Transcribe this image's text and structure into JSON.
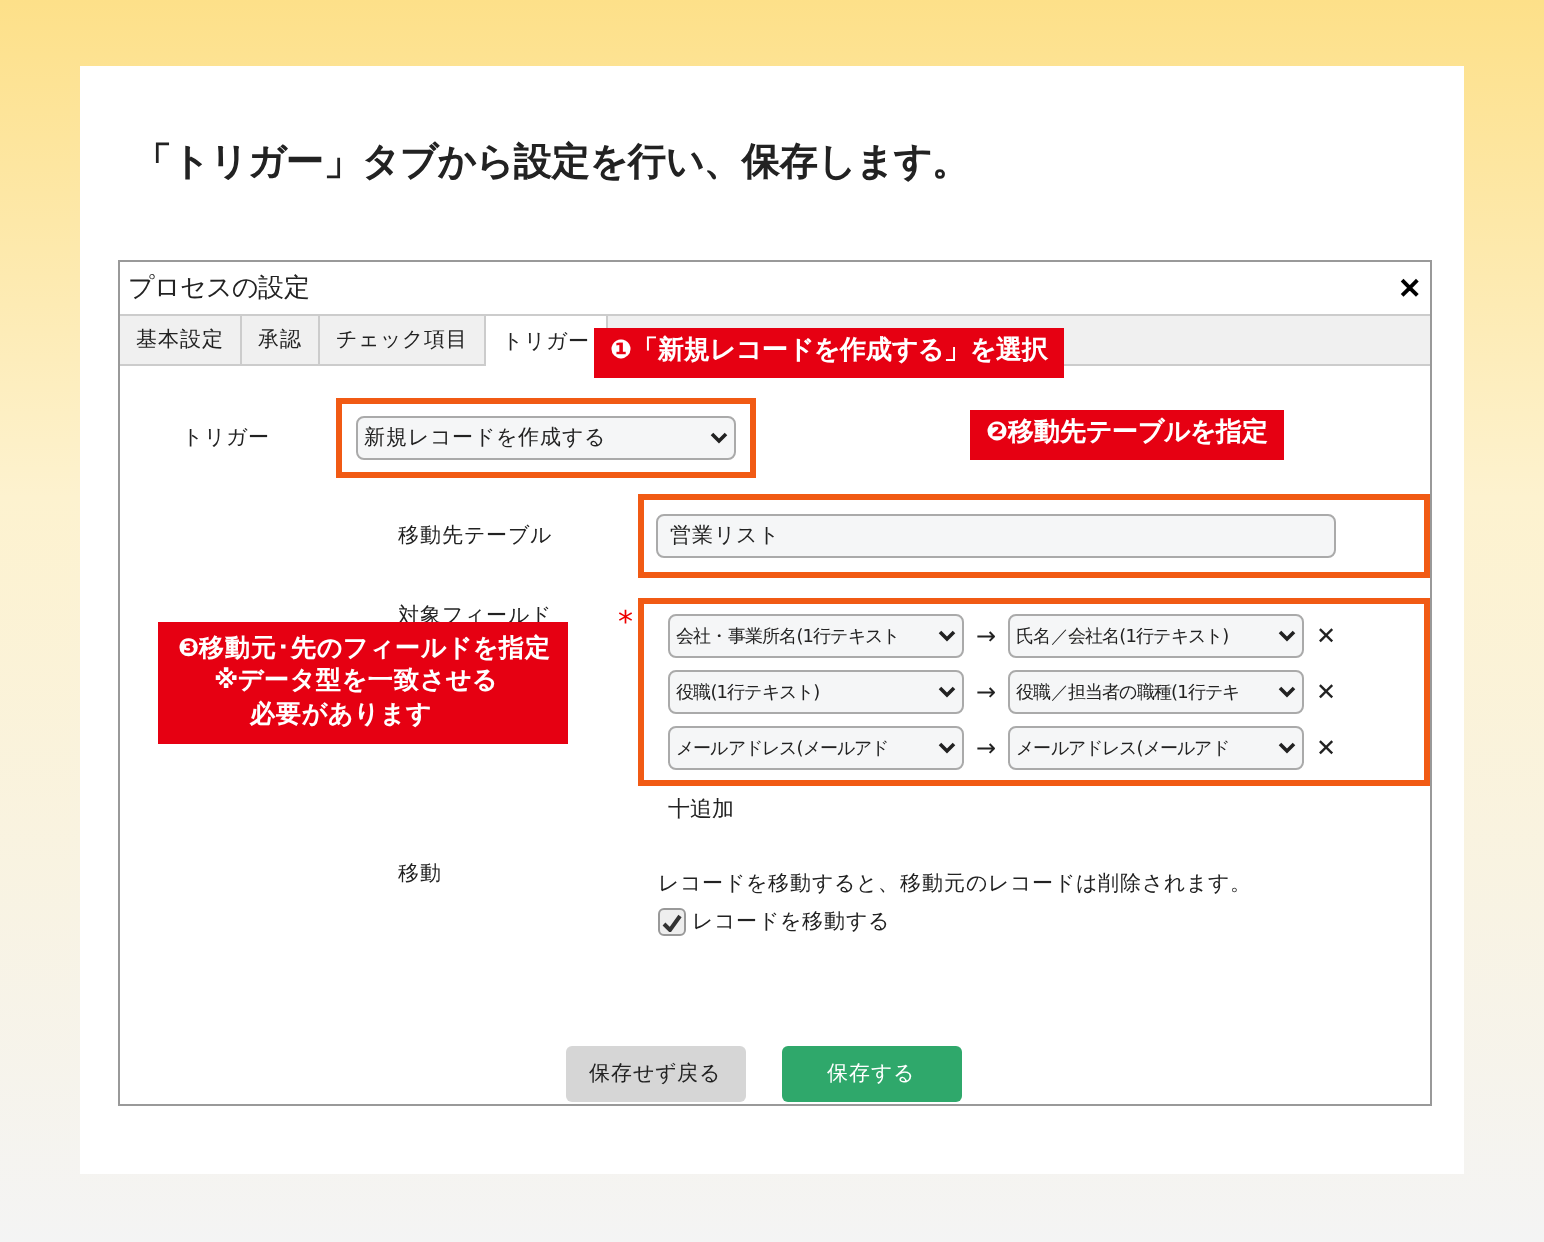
{
  "heading": "「トリガー」タブから設定を行い、保存します。",
  "dialog": {
    "title": "プロセスの設定",
    "close": "✕",
    "tabs": [
      {
        "label": "基本設定",
        "selected": false
      },
      {
        "label": "承認",
        "selected": false
      },
      {
        "label": "チェック項目",
        "selected": false
      },
      {
        "label": "トリガー",
        "selected": true
      }
    ],
    "trigger": {
      "label": "トリガー",
      "value": "新規レコードを作成する"
    },
    "target_table": {
      "label": "移動先テーブル",
      "value": "営業リスト"
    },
    "fields": {
      "label": "対象フィールド",
      "required_mark": "*",
      "arrow": "→",
      "remove": "✕",
      "rows": [
        {
          "source": "会社・事業所名(1行テキスト",
          "target": "氏名／会社名(1行テキスト)"
        },
        {
          "source": "役職(1行テキスト)",
          "target": "役職／担当者の職種(1行テキ"
        },
        {
          "source": "メールアドレス(メールアド",
          "target": "メールアドレス(メールアド"
        }
      ],
      "add": "十追加"
    },
    "move": {
      "label": "移動",
      "note": "レコードを移動すると、移動元のレコードは削除されます。",
      "checkbox": {
        "label": "レコードを移動する",
        "checked": true
      }
    },
    "buttons": [
      {
        "label": "保存せず戻る",
        "kind": "secondary"
      },
      {
        "label": "保存する",
        "kind": "primary"
      }
    ]
  },
  "callouts": [
    {
      "number": "❶",
      "text": "「新規レコードを作成する」を選択"
    },
    {
      "number": "❷",
      "text": "移動先テーブルを指定"
    },
    {
      "number": "❸",
      "lines": [
        "移動元･先のフィールドを指定",
        "※データ型を一致させる",
        "必要があります"
      ]
    }
  ]
}
